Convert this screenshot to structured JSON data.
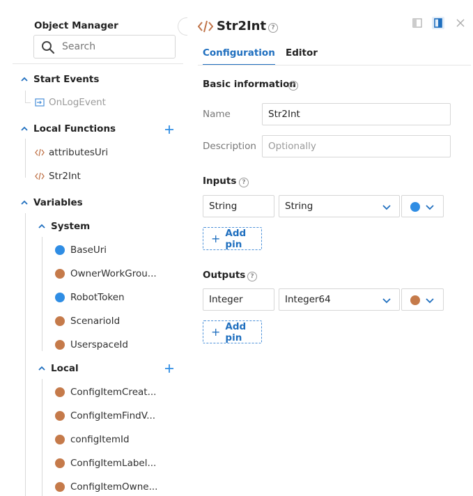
{
  "object_manager": {
    "title": "Object Manager",
    "search_placeholder": "Search"
  },
  "tree": {
    "start_events": {
      "label": "Start Events",
      "items": [
        "OnLogEvent"
      ]
    },
    "local_functions": {
      "label": "Local Functions",
      "items": [
        "attributesUri",
        "Str2Int"
      ]
    },
    "variables": {
      "label": "Variables",
      "system": {
        "label": "System",
        "items": [
          {
            "label": "BaseUri",
            "color": "blue"
          },
          {
            "label": "OwnerWorkGrou...",
            "color": "brown"
          },
          {
            "label": "RobotToken",
            "color": "blue"
          },
          {
            "label": "ScenarioId",
            "color": "brown"
          },
          {
            "label": "UserspaceId",
            "color": "brown"
          }
        ]
      },
      "local": {
        "label": "Local",
        "items": [
          {
            "label": "ConfigItemCreat...",
            "color": "brown"
          },
          {
            "label": "ConfigItemFindV...",
            "color": "brown"
          },
          {
            "label": "configItemId",
            "color": "brown"
          },
          {
            "label": "ConfigItemLabel...",
            "color": "brown"
          },
          {
            "label": "ConfigItemOwne...",
            "color": "brown"
          }
        ]
      }
    }
  },
  "editor": {
    "title": "Str2Int",
    "tabs": [
      "Configuration",
      "Editor"
    ],
    "active_tab": "Configuration",
    "basic_info": {
      "title": "Basic information",
      "name_label": "Name",
      "name_value": "Str2Int",
      "description_label": "Description",
      "description_placeholder": "Optionally"
    },
    "inputs": {
      "title": "Inputs",
      "pin_name": "String",
      "pin_type": "String",
      "pin_color": "blue",
      "add_label": "Add pin"
    },
    "outputs": {
      "title": "Outputs",
      "pin_name": "Integer",
      "pin_type": "Integer64",
      "pin_color": "brown",
      "add_label": "Add pin"
    }
  },
  "colors": {
    "accent": "#1f6fbf",
    "blue_type": "#2f8de4",
    "brown_type": "#c57a4a",
    "code_icon": "#c0744a"
  }
}
